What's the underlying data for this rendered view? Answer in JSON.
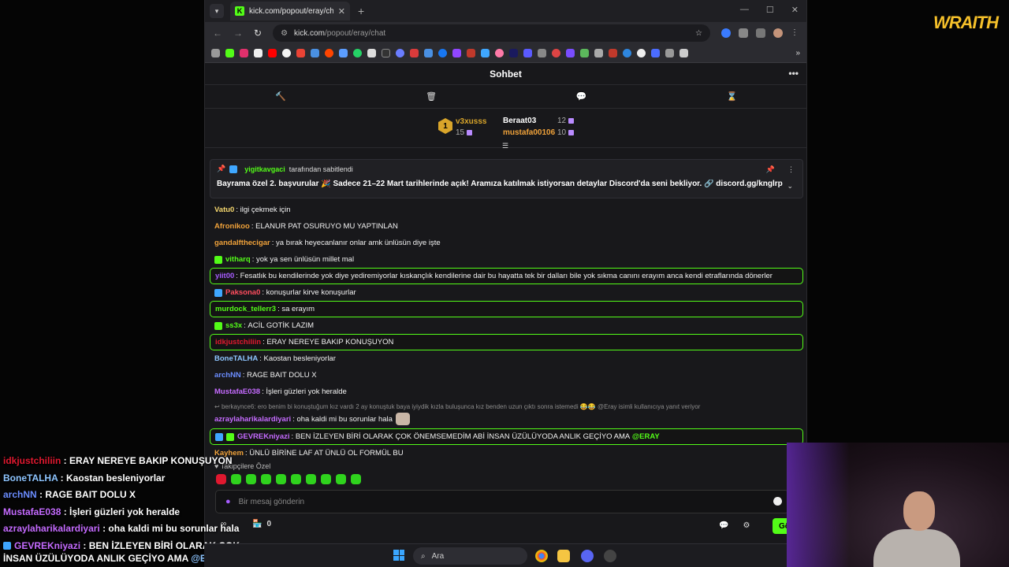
{
  "browser": {
    "tab_title": "kick.com/popout/eray/chat",
    "url_domain": "kick.com",
    "url_path": "/popout/eray/chat"
  },
  "chat": {
    "title": "Sohbet",
    "leaderboard": [
      {
        "rank": "1",
        "name": "v3xusss",
        "count": "15",
        "color": "#d9a52a"
      },
      {
        "name": "Beraat03",
        "count": "12",
        "color": "#ffffff"
      },
      {
        "name": "mustafa00106",
        "count": "10",
        "color": "#f0a23a"
      }
    ],
    "pinned": {
      "user": "yigitkavgaci",
      "suffix": "tarafından sabitlendi",
      "message": "Bayrama özel 2. başvurular 🎉 Sadece 21–22 Mart tarihlerinde açık! Aramıza katılmak istiyorsan detaylar Discord'da seni bekliyor. 🔗 discord.gg/knglrp"
    },
    "messages": [
      {
        "user": "Vatu0",
        "color": "#f5d76e",
        "text": "ilgi çekmek için"
      },
      {
        "user": "Afronikoo",
        "color": "#f0a23a",
        "text": "ELANUR PAT OSURUYO MU YAPTINLAN"
      },
      {
        "user": "gandalfthecigar",
        "color": "#f0a23a",
        "text": "ya bırak heyecanlanır onlar amk ünlüsün diye işte"
      },
      {
        "user": "vitharq",
        "color": "#53fc18",
        "text": "yok ya sen ünlüsün millet mal"
      },
      {
        "user": "yiit00",
        "color": "#a75cff",
        "text": "Fesatlık bu kendilerinde yok diye yediremiyorlar kıskançlık kendilerine dair bu hayatta tek bir dalları bile yok sıkma canını erayım anca kendi etraflarında dönerler"
      },
      {
        "user": "Paksona0",
        "color": "#ff4d5e",
        "text": "konuşurlar kirve konuşurlar"
      },
      {
        "user": "murdock_tellerr3",
        "color": "#53fc18",
        "text": "sa erayım"
      },
      {
        "user": "ss3x",
        "color": "#53fc18",
        "text": "ACİL GOTİK LAZIM"
      },
      {
        "user": "idkjustchiliin",
        "color": "#e0182f",
        "text": "ERAY NEREYE BAKIP KONUŞUYON"
      },
      {
        "user": "BoneTALHA",
        "color": "#8ec5ff",
        "text": "Kaostan besleniyorlar"
      },
      {
        "user": "archNN",
        "color": "#6b8dff",
        "text": "RAGE BAIT DOLU X"
      },
      {
        "user": "MustafaE038",
        "color": "#c56bff",
        "text": "İşleri güzleri yok heralde"
      },
      {
        "reply": "berkaynce6: ero benim bi konuştuğum kız vardı 2 ay konuştuk baya iyiydik kızla buluşunca kız benden uzun çıktı sonra istemedi 😂😂 @Eray isimli kullanıcıya yanıt veriyor",
        "user": "azraylaharikalardiyari",
        "color": "#c56bff",
        "text": "oha kaldi mi bu sorunlar hala"
      },
      {
        "user": "GEVREKniyazi",
        "color": "#c56bff",
        "text": "BEN İZLEYEN BİRİ OLARAK ÇOK ÖNEMSEMEDİM ABİ İNSAN ÜZÜLÜYODA ANLIK GEÇİYO AMA",
        "mention": "@ERAY"
      },
      {
        "user": "Kayhem",
        "color": "#f0a23a",
        "text": "ÜNLÜ BİRİNE LAF AT ÜNLÜ OL FORMÜL BU"
      }
    ],
    "follower_only": "Takipçilere Özel",
    "input_placeholder": "Bir mesaj gönderin",
    "points": "0",
    "send_label": "Gönder"
  },
  "overlay": [
    {
      "user": "idkjustchiliin",
      "color": "#e0182f",
      "text": " : ERAY NEREYE BAKIP KONUŞUYON"
    },
    {
      "user": "BoneTALHA",
      "color": "#8ec5ff",
      "text": " : Kaostan besleniyorlar"
    },
    {
      "user": "archNN",
      "color": "#6b8dff",
      "text": " : RAGE BAIT DOLU X"
    },
    {
      "user": "MustafaE038",
      "color": "#c56bff",
      "text": " : İşleri güzleri yok heralde"
    },
    {
      "user": "azraylaharikalardiyari",
      "color": "#c56bff",
      "text": " : oha kaldi mi bu sorunlar hala"
    },
    {
      "user": "GEVREKniyazi",
      "color": "#c56bff",
      "text": " : BEN İZLEYEN BİRİ OLARAK ÇOK ÖNEMSEMEDİM ABİ"
    },
    {
      "user": "",
      "color": "#ffffff",
      "text": "İNSAN ÜZÜLÜYODA ANLIK GEÇİYO AMA ",
      "mention": "@ERAY"
    }
  ],
  "branding": {
    "logo": "WRAITH"
  },
  "taskbar": {
    "search_placeholder": "Ara"
  }
}
